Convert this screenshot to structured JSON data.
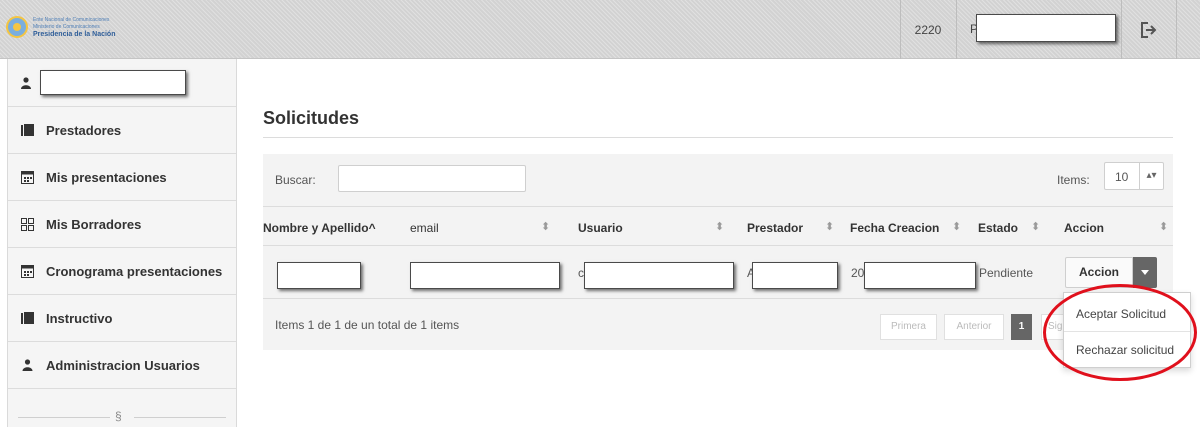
{
  "header": {
    "logo_line1": "Ente Nacional de Comunicaciones",
    "logo_line2": "Ministerio de Comunicaciones",
    "logo_line3": "Presidencia de la Nación",
    "code": "2220",
    "user_initial": "P"
  },
  "sidebar": {
    "items": [
      {
        "label": "Prestadores",
        "icon": "book-icon"
      },
      {
        "label": "Mis presentaciones",
        "icon": "calendar-icon"
      },
      {
        "label": "Mis Borradores",
        "icon": "grid-icon"
      },
      {
        "label": "Cronograma presentaciones",
        "icon": "calendar-icon"
      },
      {
        "label": "Instructivo",
        "icon": "book-icon"
      },
      {
        "label": "Administracion Usuarios",
        "icon": "user-icon"
      }
    ],
    "footer_mark": "§"
  },
  "main": {
    "title": "Solicitudes",
    "search_label": "Buscar:",
    "search_value": "",
    "items_label": "Items:",
    "items_value": "10",
    "columns": [
      "Nombre y Apellido^",
      "email",
      "Usuario",
      "Prestador",
      "Fecha Creacion",
      "Estado",
      "Accion"
    ],
    "row": {
      "usuario_prefix": "c",
      "prestador_prefix": "A",
      "fecha_prefix": "20",
      "estado": "Pendiente"
    },
    "accion_button": "Accion",
    "dropdown": [
      "Aceptar Solicitud",
      "Rechazar solicitud"
    ],
    "summary": "Items 1 de 1 de un total de 1 items",
    "pagination": {
      "first": "Primera",
      "prev": "Anterior",
      "current": "1",
      "next": "Sig"
    }
  },
  "colors": {
    "highlight": "#e0101c",
    "active_page": "#666666"
  }
}
